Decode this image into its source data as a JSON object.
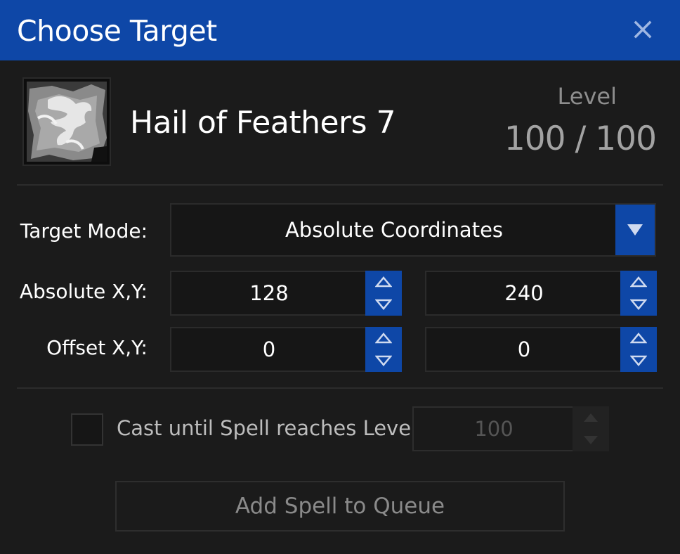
{
  "window": {
    "title": "Choose Target"
  },
  "spell": {
    "name": "Hail of Feathers 7",
    "level_label": "Level",
    "level_value": "100 / 100"
  },
  "form": {
    "target_mode_label": "Target Mode:",
    "target_mode_value": "Absolute Coordinates",
    "absolute_label": "Absolute X,Y:",
    "absolute_x": "128",
    "absolute_y": "240",
    "offset_label": "Offset X,Y:",
    "offset_x": "0",
    "offset_y": "0"
  },
  "cast_until": {
    "label": "Cast until Spell reaches Level:",
    "checked": false,
    "level": "100",
    "enabled": false
  },
  "actions": {
    "add_label": "Add Spell to Queue",
    "enabled": false
  },
  "colors": {
    "accent": "#0e47a7",
    "background": "#1b1b1b",
    "field": "#161616"
  },
  "icons": {
    "close": "close-icon",
    "dropdown": "chevron-down-icon",
    "up": "triangle-up-icon",
    "down": "triangle-down-icon",
    "spell": "feather-spell-icon"
  }
}
